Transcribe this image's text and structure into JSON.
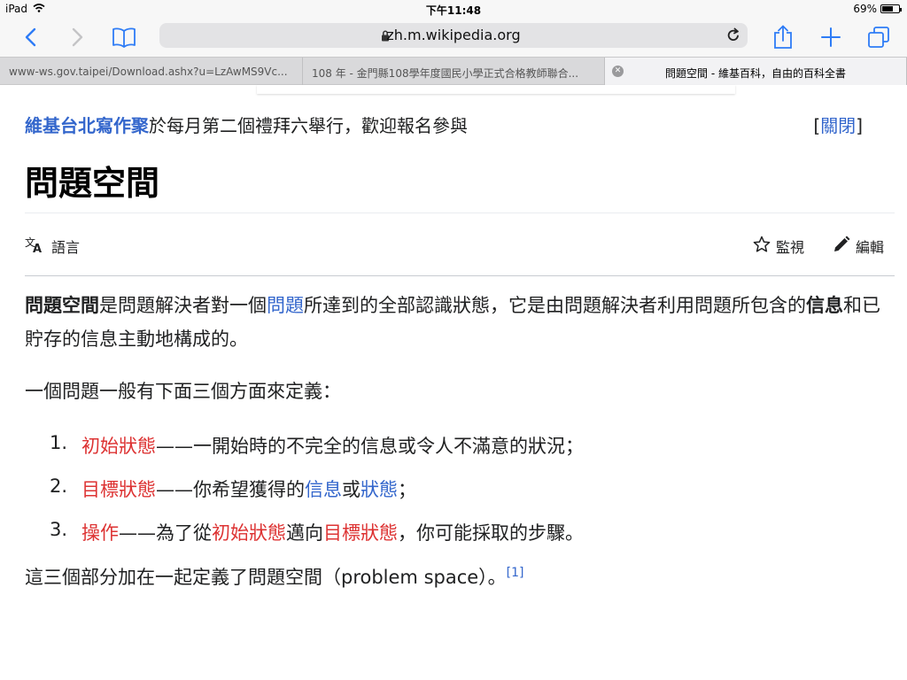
{
  "status_bar": {
    "device": "iPad",
    "time": "下午11:48",
    "battery": "69%",
    "battery_level": 0.69
  },
  "toolbar": {
    "url": "zh.m.wikipedia.org"
  },
  "tabs": [
    {
      "title": "www-ws.gov.taipei/Download.ashx?u=LzAwMS9Vc...",
      "active": false
    },
    {
      "title": "108 年 - 金門縣108學年度國民小學正式合格教師聯合...",
      "active": false
    },
    {
      "title": "問題空間 - 維基百科，自由的百科全書",
      "active": true
    }
  ],
  "banner": {
    "link": "維基台北寫作聚",
    "text": "於每月第二個禮拜六舉行，歡迎報名參與",
    "close_open": "[",
    "close_label": "關閉",
    "close_end": "]"
  },
  "page": {
    "title": "問題空間",
    "language_label": "語言",
    "watch_label": "監視",
    "edit_label": "編輯"
  },
  "article": {
    "p1_bold": "問題空間",
    "p1_a": "是問題解決者對一個",
    "p1_link": "問題",
    "p1_b": "所達到的全部認識狀態，它是由問題解決者利用問題所包含的",
    "p1_bold2": "信息",
    "p1_c": "和已貯存的信息主動地構成的。",
    "p2": "一個問題一般有下面三個方面來定義：",
    "list": [
      {
        "num": "1.",
        "red": "初始狀態",
        "text": "——一開始時的不完全的信息或令人不滿意的狀況；"
      },
      {
        "num": "2.",
        "red": "目標狀態",
        "text": "——你希望獲得的",
        "link1": "信息",
        "mid": "或",
        "link2": "狀態",
        "end": "；"
      },
      {
        "num": "3.",
        "red": "操作",
        "text": "——為了從",
        "red2": "初始狀態",
        "mid": "邁向",
        "red3": "目標狀態",
        "end": "，你可能採取的步驟。"
      }
    ],
    "p3": "這三個部分加在一起定義了問題空間（problem space）。",
    "ref": "[1]"
  }
}
